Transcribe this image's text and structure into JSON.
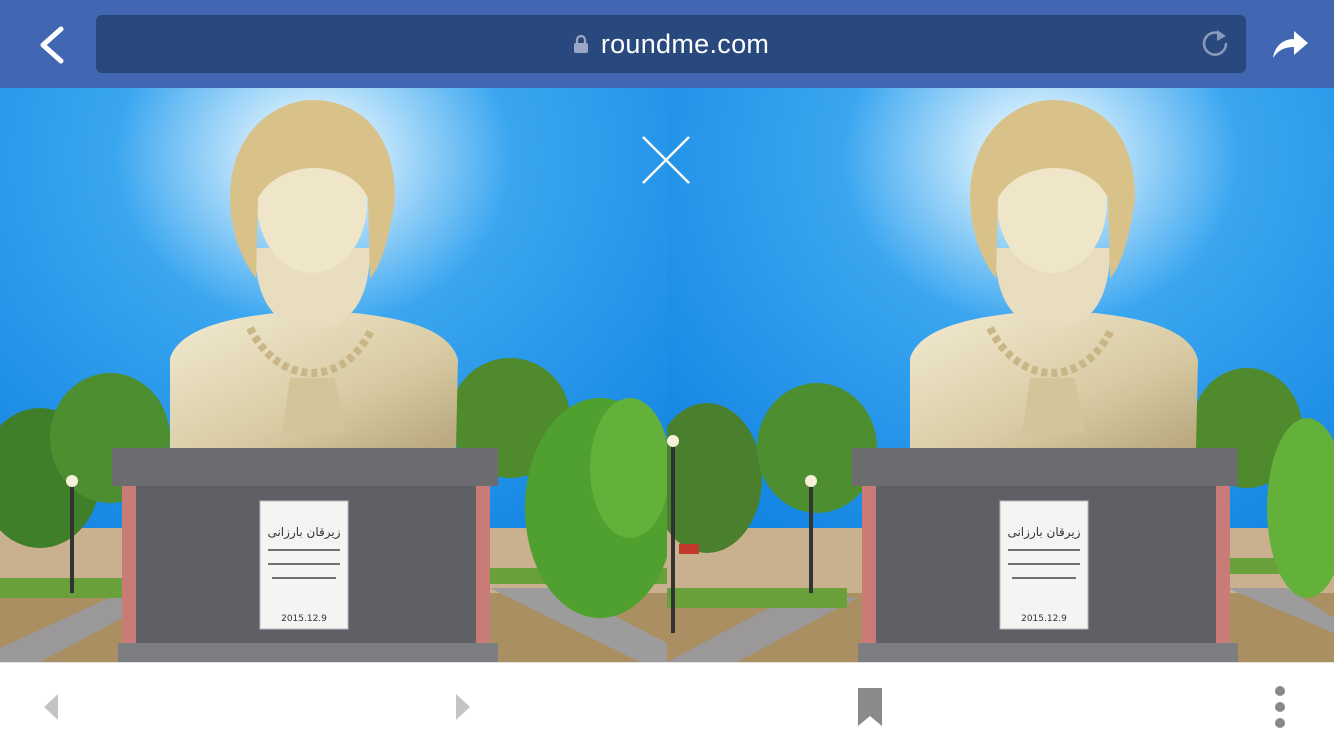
{
  "browser": {
    "url": "roundme.com",
    "icons": {
      "back": "chevron-left-icon",
      "lock": "lock-icon",
      "reload": "reload-icon",
      "share": "share-icon"
    }
  },
  "viewer": {
    "mode": "vr-split-stereo",
    "close_icon": "close-icon",
    "plaque": {
      "lines": [
        "زیرقان بارزانی"
      ],
      "date": "2015.12.9"
    }
  },
  "toolbar": {
    "icons": [
      "nav-back-icon",
      "nav-forward-icon",
      "bookmark-icon",
      "more-icon"
    ]
  },
  "colors": {
    "topbar": "#4267b2",
    "urlbar": "#29487d",
    "sky": "#1e8fe8",
    "bottombar": "#ffffff",
    "toolbar_icon_disabled": "#c4c4c4",
    "toolbar_icon_active": "#8a8a8a"
  }
}
